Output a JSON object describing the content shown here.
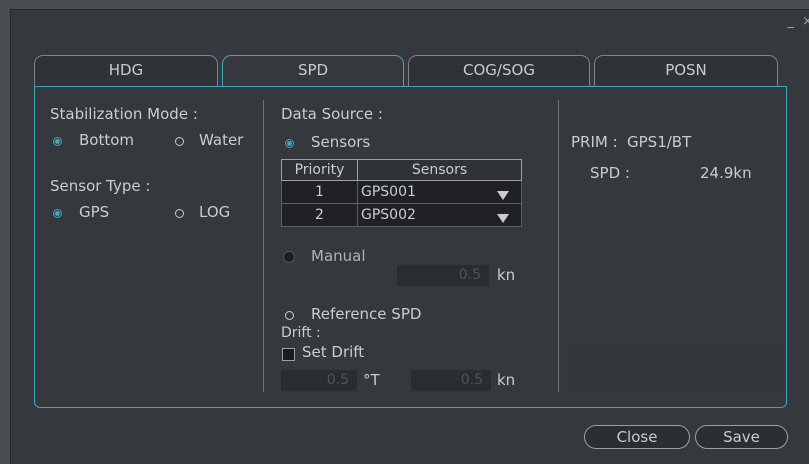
{
  "window": {
    "controls": "_ ×"
  },
  "tabs": [
    {
      "label": "HDG",
      "active": false
    },
    {
      "label": "SPD",
      "active": true
    },
    {
      "label": "COG/SOG",
      "active": false
    },
    {
      "label": "POSN",
      "active": false
    }
  ],
  "stabilization": {
    "label": "Stabilization Mode :",
    "options": [
      {
        "label": "Bottom",
        "selected": true
      },
      {
        "label": "Water",
        "selected": false
      }
    ]
  },
  "sensor_type": {
    "label": "Sensor Type :",
    "options": [
      {
        "label": "GPS",
        "selected": true
      },
      {
        "label": "LOG",
        "selected": false
      }
    ]
  },
  "data_source": {
    "label": "Data Source :",
    "sensors_label": "Sensors",
    "table": {
      "headers": [
        "Priority",
        "Sensors"
      ],
      "rows": [
        {
          "priority": "1",
          "sensor": "GPS001"
        },
        {
          "priority": "2",
          "sensor": "GPS002"
        }
      ]
    },
    "manual_label": "Manual",
    "manual_value": "0.5",
    "manual_unit": "kn",
    "reference_label": "Reference SPD",
    "drift_label": "Drift :",
    "set_drift_label": "Set Drift",
    "drift_dir_value": "0.5",
    "drift_dir_unit": "°T",
    "drift_speed_value": "0.5",
    "drift_speed_unit": "kn"
  },
  "status": {
    "prim_label": "PRIM :",
    "prim_value": "GPS1/BT",
    "spd_label": "SPD :",
    "spd_value": "24.9kn"
  },
  "buttons": {
    "close": "Close",
    "save": "Save"
  },
  "colors": {
    "accent": "#3aa7bd",
    "background": "#35383d",
    "text": "#c9cdd2"
  }
}
